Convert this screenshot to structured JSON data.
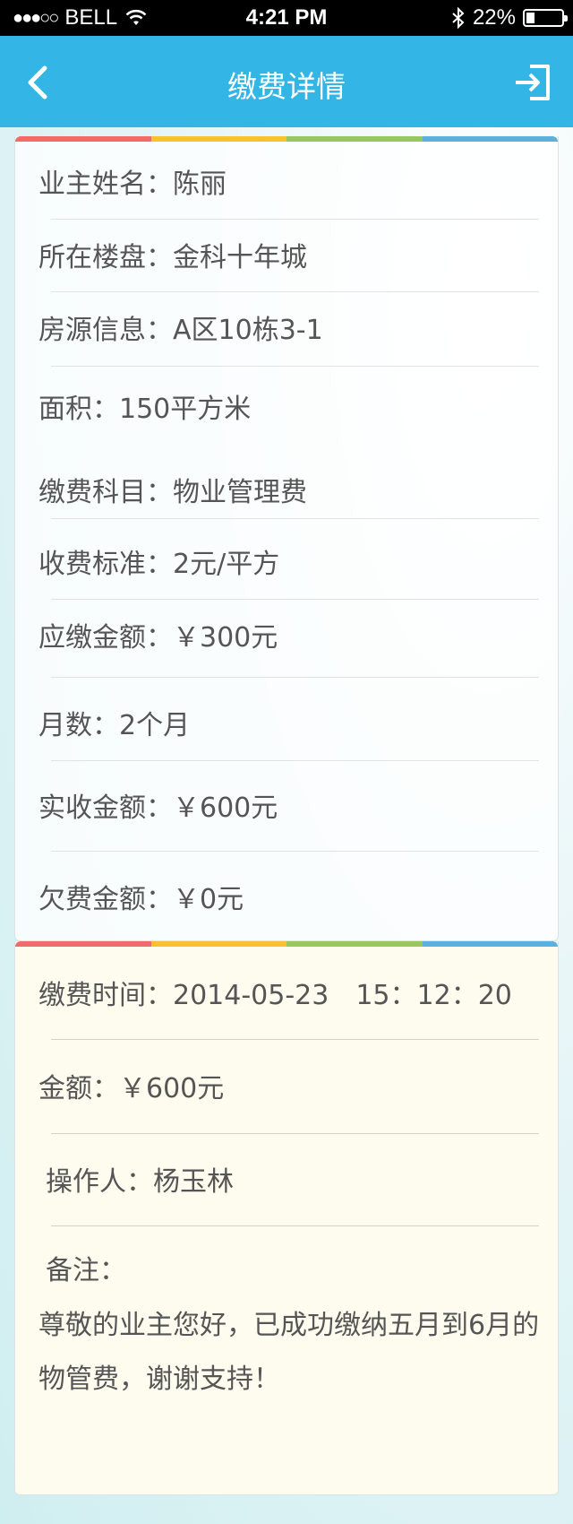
{
  "status_bar": {
    "carrier": "BELL",
    "time": "4:21 PM",
    "battery": "22%"
  },
  "nav": {
    "title": "缴费详情"
  },
  "colors": {
    "nav_bg": "#33b5e5",
    "stripe": [
      "#f26b6b",
      "#f9c02f",
      "#97c75d",
      "#5bb0de"
    ]
  },
  "details": {
    "owner_name": "业主姓名：陈丽",
    "property": "所在楼盘：金科十年城",
    "unit_info": "房源信息：A区10栋3-1",
    "area": "面积：150平方米",
    "fee_item": "缴费科目：物业管理费",
    "fee_standard": "收费标准：2元/平方",
    "amount_due": "应缴金额：￥300元",
    "months": "月数：2个月",
    "amount_received": "实收金额：￥600元",
    "arrears": "欠费金额：￥0元"
  },
  "payment": {
    "pay_time": "缴费时间：2014-05-23　15：12：20",
    "amount": "金额：￥600元",
    "operator": "操作人：杨玉林",
    "remark_label": "备注：",
    "remark_line1": "尊敬的业主您好，已成功缴纳五月到6月的",
    "remark_line2": "物管费，谢谢支持！"
  }
}
